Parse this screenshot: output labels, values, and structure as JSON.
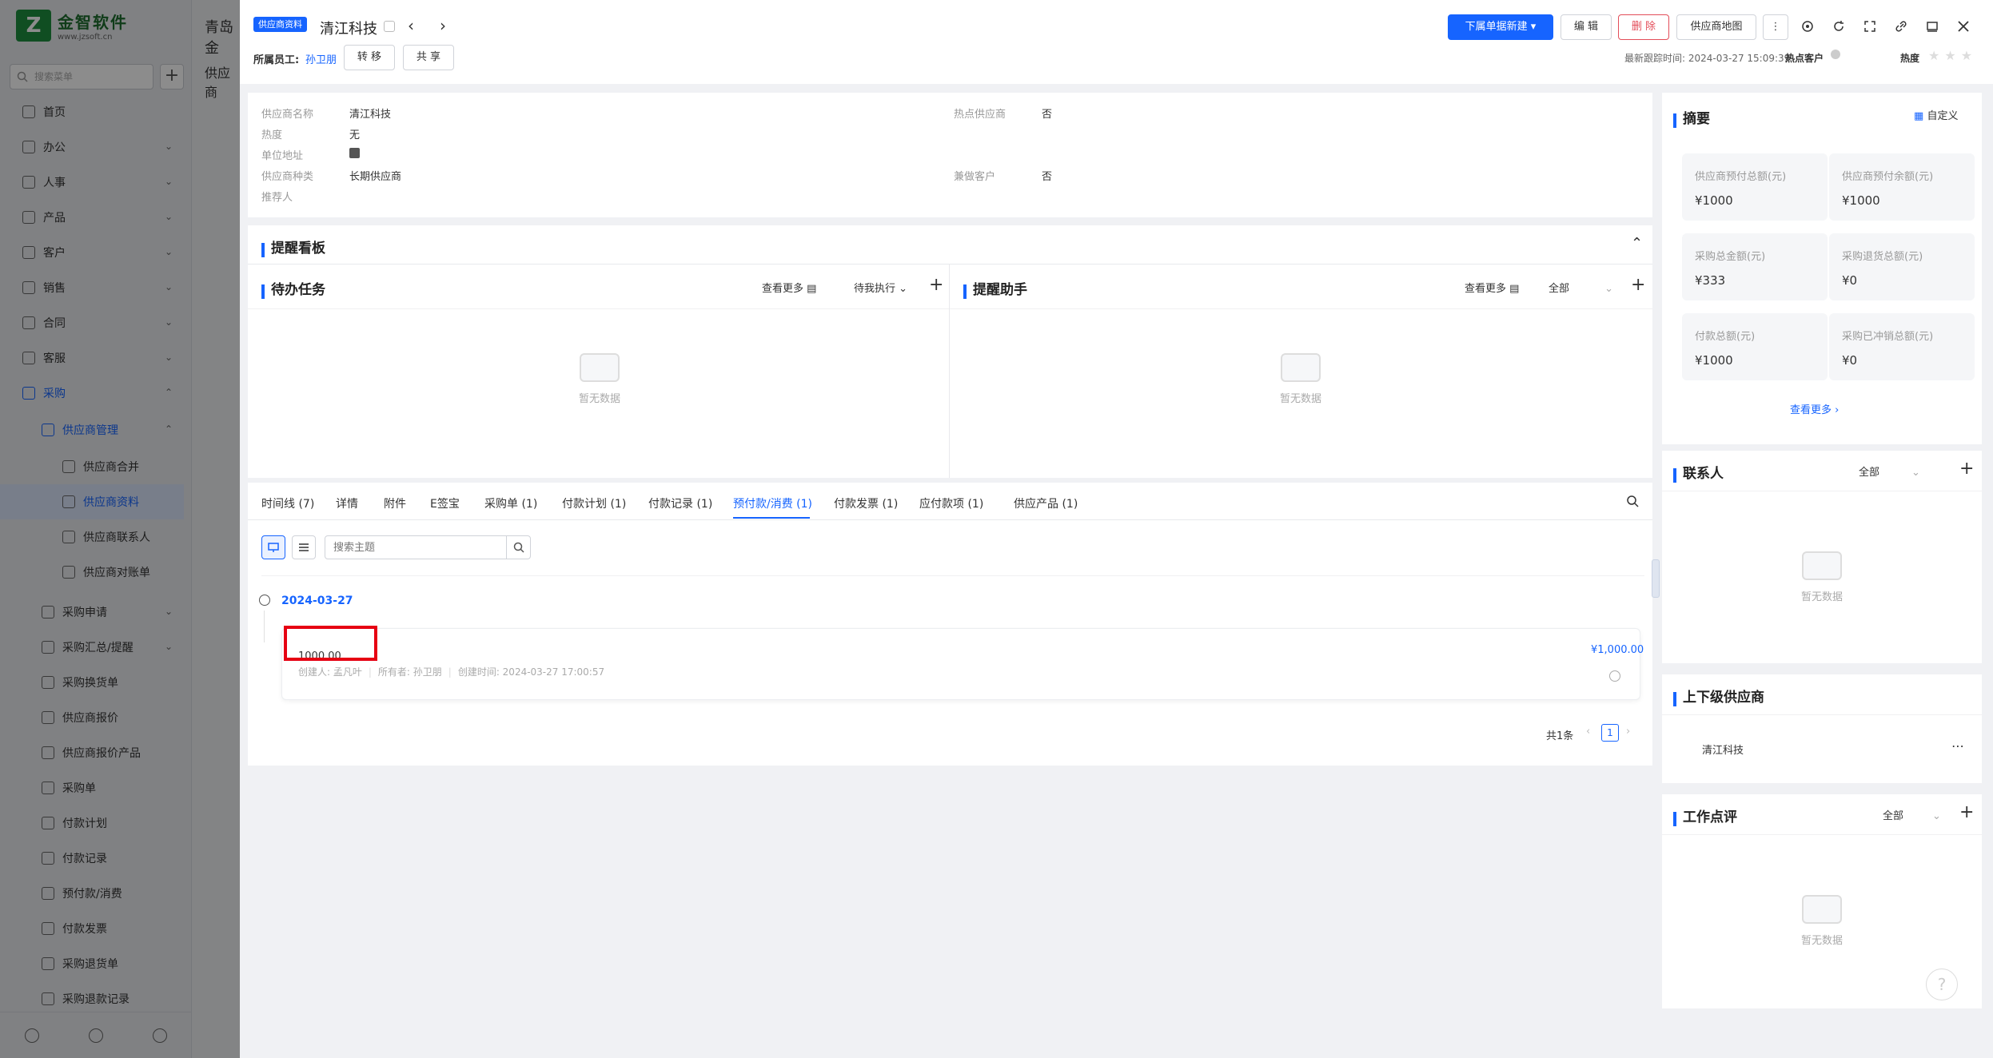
{
  "sidebar": {
    "logo_name": "金智软件",
    "logo_url": "www.jzsoft.cn",
    "search_placeholder": "搜索菜单",
    "items": [
      {
        "label": "首页",
        "level": 0
      },
      {
        "label": "办公",
        "level": 0
      },
      {
        "label": "人事",
        "level": 0
      },
      {
        "label": "产品",
        "level": 0
      },
      {
        "label": "客户",
        "level": 0
      },
      {
        "label": "销售",
        "level": 0
      },
      {
        "label": "合同",
        "level": 0
      },
      {
        "label": "客服",
        "level": 0
      },
      {
        "label": "采购",
        "level": 0,
        "active": true
      },
      {
        "label": "供应商管理",
        "level": 1,
        "active": true
      },
      {
        "label": "供应商合并",
        "level": 2
      },
      {
        "label": "供应商资料",
        "level": 2,
        "selected": true
      },
      {
        "label": "供应商联系人",
        "level": 2
      },
      {
        "label": "供应商对账单",
        "level": 2
      },
      {
        "label": "采购申请",
        "level": 1
      },
      {
        "label": "采购汇总/提醒",
        "level": 1
      },
      {
        "label": "采购换货单",
        "level": 1
      },
      {
        "label": "供应商报价",
        "level": 1
      },
      {
        "label": "供应商报价产品",
        "level": 1
      },
      {
        "label": "采购单",
        "level": 1
      },
      {
        "label": "付款计划",
        "level": 1
      },
      {
        "label": "付款记录",
        "level": 1
      },
      {
        "label": "预付款/消费",
        "level": 1
      },
      {
        "label": "付款发票",
        "level": 1
      },
      {
        "label": "采购退货单",
        "level": 1
      },
      {
        "label": "采购退款记录",
        "level": 1
      }
    ]
  },
  "background": {
    "crumb1": "青岛金",
    "crumb2": "供应商"
  },
  "header": {
    "tag": "供应商资料",
    "title": "清江科技",
    "owner_label": "所属员工:",
    "owner_name": "孙卫朋",
    "transfer": "转 移",
    "share": "共 享",
    "new_btn": "下属单据新建",
    "edit": "编 辑",
    "delete": "删 除",
    "map": "供应商地图",
    "last_track": "最新跟踪时间: 2024-03-27 15:09:39",
    "hot_customer": "热点客户",
    "heat": "热度"
  },
  "info": {
    "name_label": "供应商名称",
    "name": "清江科技",
    "heat_label": "热度",
    "heat": "无",
    "addr_label": "单位地址",
    "type_label": "供应商种类",
    "type": "长期供应商",
    "ref_label": "推荐人",
    "hot_label": "热点供应商",
    "hot": "否",
    "also_cust_label": "兼做客户",
    "also_cust": "否"
  },
  "reminder": {
    "title": "提醒看板",
    "todo": {
      "title": "待办任务",
      "more": "查看更多",
      "filter": "待我执行",
      "empty": "暂无数据"
    },
    "assistant": {
      "title": "提醒助手",
      "more": "查看更多",
      "filter": "全部",
      "empty": "暂无数据"
    }
  },
  "tabs": [
    {
      "label": "时间线 (7)"
    },
    {
      "label": "详情"
    },
    {
      "label": "附件"
    },
    {
      "label": "E签宝"
    },
    {
      "label": "采购单 (1)"
    },
    {
      "label": "付款计划 (1)"
    },
    {
      "label": "付款记录 (1)"
    },
    {
      "label": "预付款/消费 (1)",
      "active": true
    },
    {
      "label": "付款发票 (1)"
    },
    {
      "label": "应付款项 (1)"
    },
    {
      "label": "供应产品 (1)"
    }
  ],
  "records": {
    "search_placeholder": "搜索主题",
    "date": "2024-03-27",
    "item": {
      "amount": "1000.00",
      "money": "¥1,000.00",
      "creator": "创建人: 孟凡叶",
      "owner": "所有者: 孙卫朋",
      "created": "创建时间: 2024-03-27 17:00:57"
    },
    "total": "共1条",
    "page": "1"
  },
  "summary": {
    "title": "摘要",
    "custom": "自定义",
    "cells": [
      {
        "label": "供应商预付总额(元)",
        "value": "¥1000"
      },
      {
        "label": "供应商预付余额(元)",
        "value": "¥1000"
      },
      {
        "label": "采购总金额(元)",
        "value": "¥333"
      },
      {
        "label": "采购退货总额(元)",
        "value": "¥0"
      },
      {
        "label": "付款总额(元)",
        "value": "¥1000"
      },
      {
        "label": "采购已冲销总额(元)",
        "value": "¥0"
      }
    ],
    "more": "查看更多"
  },
  "contacts": {
    "title": "联系人",
    "filter": "全部",
    "empty": "暂无数据"
  },
  "upstream": {
    "title": "上下级供应商",
    "item": "清江科技"
  },
  "review": {
    "title": "工作点评",
    "filter": "全部",
    "empty": "暂无数据"
  },
  "colors": {
    "accent": "#1664ff",
    "danger": "#e34d59",
    "highlight": "#e60012"
  }
}
